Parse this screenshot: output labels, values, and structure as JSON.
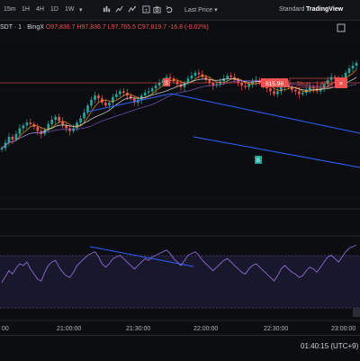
{
  "toolbar": {
    "intervals": [
      "15m",
      "1H",
      "4H",
      "1D",
      "1W"
    ],
    "last_price_label": "Last Price",
    "standard_label": "Standard",
    "tradingview_label": "TradingView"
  },
  "symbol_header": {
    "symbol": "SDT · 1 · BingX",
    "ohlc": "O97,836.7  H97,836.7  L97,765.5  C97,819.7  -16.8 (-0.02%)"
  },
  "annotations": {
    "price_tag": "615.96",
    "short_label": "Short · 1.6751",
    "sell_marker": "S",
    "buy_marker": "B"
  },
  "time_axis": {
    "labels": [
      "00",
      "21:00:00",
      "21:30:00",
      "22:00:00",
      "22:30:00",
      "23:00:00"
    ]
  },
  "status_bar": {
    "clock": "01:40:15 (UTC+9)"
  },
  "colors": {
    "background": "#0c0d10",
    "up_candle": "#26a69a",
    "down_candle": "#ef5350",
    "trend_line": "#2962ff",
    "rsi_line": "#7e57c2",
    "ma_orange": "#f7931a"
  },
  "chart_data": {
    "type": "candlestick",
    "title": "",
    "closes": [
      30,
      34,
      38,
      36,
      40,
      44,
      46,
      48,
      47,
      45,
      42,
      40,
      43,
      47,
      50,
      52,
      49,
      46,
      44,
      42,
      44,
      48,
      51,
      55,
      60,
      64,
      67,
      65,
      62,
      60,
      62,
      66,
      68,
      70,
      69,
      67,
      65,
      62,
      64,
      67,
      69,
      70,
      72,
      74,
      76,
      78,
      80,
      79,
      77,
      75,
      73,
      76,
      79,
      81,
      83,
      82,
      80,
      78,
      76,
      74,
      75,
      77,
      79,
      81,
      80,
      78,
      76,
      74,
      73,
      75,
      77,
      78,
      76,
      74,
      72,
      70,
      68,
      70,
      73,
      75,
      73,
      71,
      70,
      68,
      69,
      71,
      73,
      72,
      70,
      72,
      75,
      78,
      80,
      79,
      77,
      79,
      83,
      86,
      88,
      90
    ],
    "rsi": [
      38,
      45,
      52,
      48,
      55,
      60,
      58,
      62,
      54,
      48,
      42,
      40,
      50,
      58,
      62,
      64,
      56,
      50,
      46,
      44,
      50,
      58,
      62,
      66,
      70,
      72,
      74,
      68,
      60,
      56,
      60,
      66,
      68,
      70,
      66,
      62,
      58,
      54,
      58,
      62,
      66,
      64,
      68,
      70,
      72,
      74,
      76,
      72,
      66,
      62,
      58,
      64,
      70,
      72,
      74,
      70,
      64,
      60,
      56,
      52,
      56,
      60,
      64,
      66,
      62,
      58,
      54,
      50,
      48,
      54,
      58,
      60,
      56,
      52,
      48,
      44,
      40,
      46,
      54,
      58,
      54,
      50,
      48,
      44,
      46,
      52,
      56,
      54,
      50,
      56,
      62,
      68,
      70,
      66,
      62,
      68,
      74,
      78,
      80,
      82
    ]
  }
}
